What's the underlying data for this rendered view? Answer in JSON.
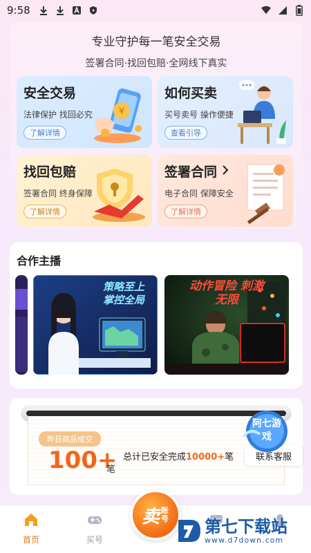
{
  "status_bar": {
    "time": "9:58"
  },
  "hero": {
    "title": "专业守护每一笔安全交易",
    "subtitle": "签署合同·找回包赔·全网线下真实",
    "cards": [
      {
        "title": "安全交易",
        "desc": "法律保护  找回必究",
        "button": "了解详情"
      },
      {
        "title": "如何买卖",
        "desc": "买号卖号  操作便捷",
        "button": "查看引导"
      },
      {
        "title": "找回包赔",
        "desc": "签署合同  终身保障",
        "button": "了解详情"
      },
      {
        "title": "签署合同",
        "desc": "电子合同  保障安全",
        "button": "了解详情"
      }
    ]
  },
  "partner": {
    "title": "合作主播",
    "thumb1_caption": "策略至上 掌控全局",
    "thumb2_caption": "动作冒险 刺激无限"
  },
  "trade": {
    "yesterday_label": "昨日商品成交",
    "count": "100+",
    "unit": "笔",
    "total_prefix": "总计已安全完成",
    "total_value": "10000+",
    "total_suffix": "笔",
    "service_button": "联系客服",
    "badge": "阿七游戏"
  },
  "fab": {
    "char": "卖",
    "small": "账号"
  },
  "tabs": [
    {
      "label": "首页",
      "icon": "home-icon",
      "active": true
    },
    {
      "label": "买号",
      "icon": "gamepad-icon",
      "active": false
    },
    {
      "label": "",
      "icon": "message-icon",
      "active": false
    },
    {
      "label": "",
      "icon": "profile-icon",
      "active": false
    }
  ],
  "watermark": {
    "brand": "第七下载站",
    "url": "www.d7down.com"
  },
  "colors": {
    "accent": "#f2661a",
    "tab_active": "#e57c10",
    "brand_blue": "#1e5aa8"
  }
}
